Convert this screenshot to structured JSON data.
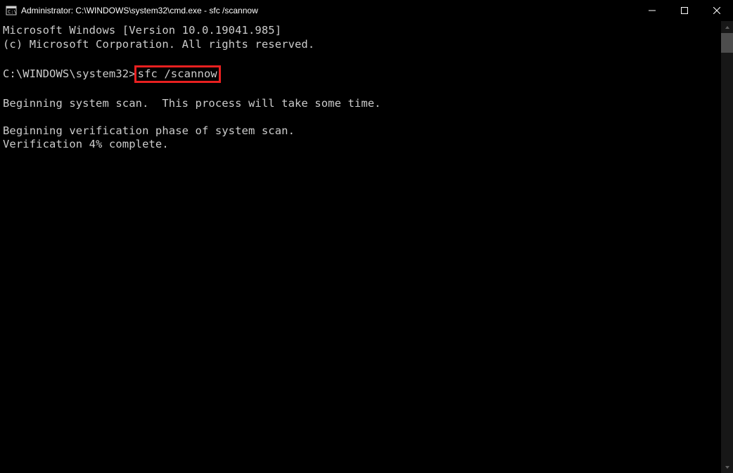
{
  "titlebar": {
    "text": "Administrator: C:\\WINDOWS\\system32\\cmd.exe - sfc  /scannow"
  },
  "console": {
    "line1": "Microsoft Windows [Version 10.0.19041.985]",
    "line2": "(c) Microsoft Corporation. All rights reserved.",
    "prompt": "C:\\WINDOWS\\system32>",
    "command": "sfc /scannow",
    "line4": "Beginning system scan.  This process will take some time.",
    "line5": "Beginning verification phase of system scan.",
    "line6": "Verification 4% complete."
  }
}
